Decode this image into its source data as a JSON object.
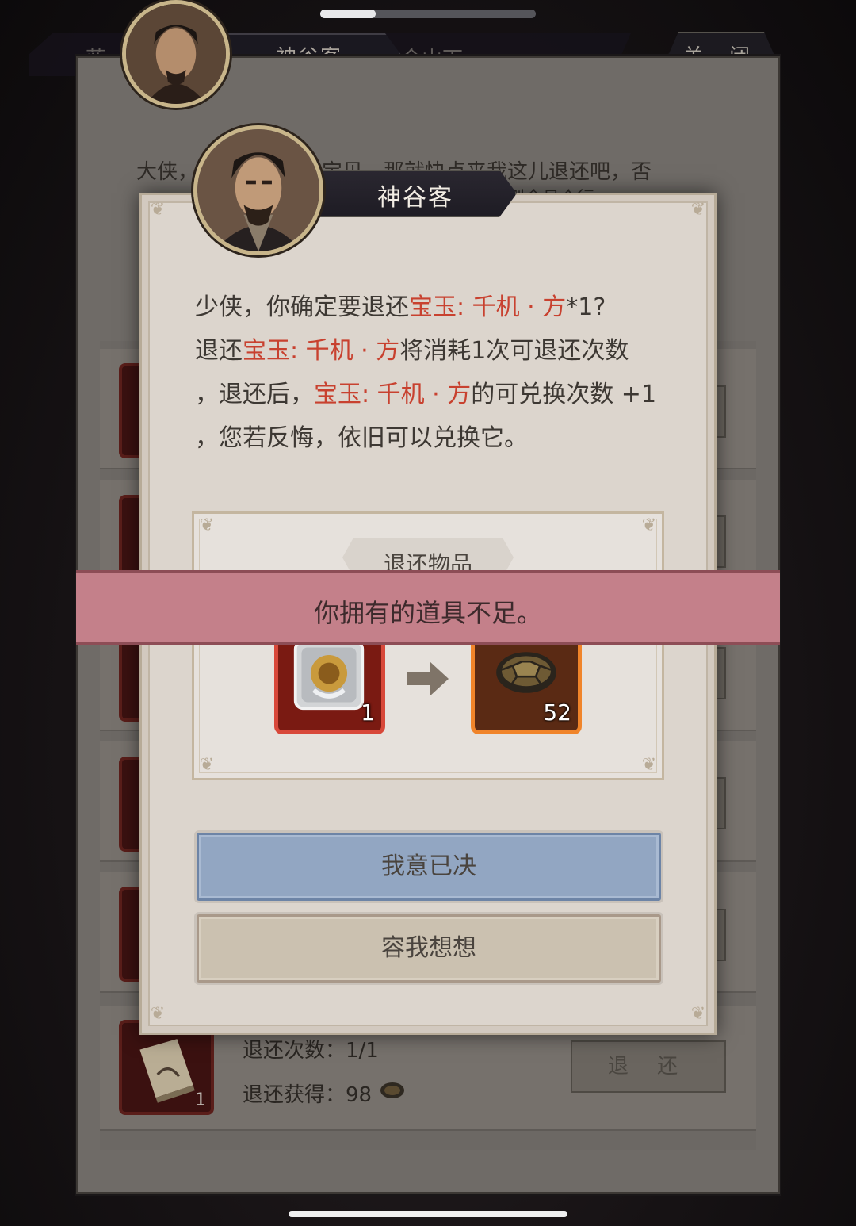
{
  "background": {
    "top_name": "神谷客",
    "close_label": "关 闭",
    "partial_title_left": "蓝",
    "partial_title_right": "今山下",
    "intro_line1": "大侠，若是你错换了宝贝，那就快点来我这儿退还吧，否",
    "intro_line2": "则令月个行",
    "last_row": {
      "count_label": "退还次数：1/1",
      "reward_label": "退还获得：98",
      "item_qty": "1",
      "button_label": "退 还"
    }
  },
  "dialog": {
    "npc_name": "神谷客",
    "message": {
      "l1_a": "少侠，你确定要退还",
      "l1_item": "宝玉: 千机 · 方",
      "l1_b": "*1?",
      "l2_a": "退还",
      "l2_item": "宝玉: 千机 · 方",
      "l2_b": "将消耗1次可退还次数",
      "l3_a": "，退还后，",
      "l3_item": "宝玉: 千机 · 方",
      "l3_b": "的可兑换次数 +1",
      "l4": "，您若反悔，依旧可以兑换它。"
    },
    "items_title": "退还物品",
    "from_item": {
      "qty": "1",
      "icon": "jade-icon"
    },
    "to_item": {
      "qty": "52",
      "icon": "turtle-shell-icon"
    },
    "confirm_label": "我意已决",
    "cancel_label": "容我想想"
  },
  "toast": {
    "text": "你拥有的道具不足。"
  },
  "colors": {
    "highlight": "#c8412f",
    "confirm": "#92a6c2",
    "cancel": "#cbc1b0",
    "toast": "#c4808a"
  }
}
